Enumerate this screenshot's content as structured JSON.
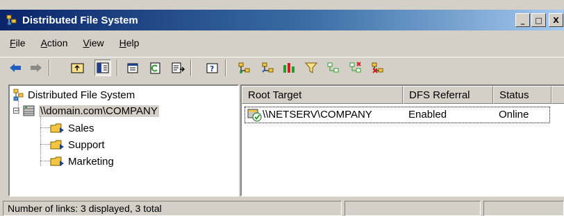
{
  "window": {
    "title": "Distributed File System"
  },
  "window_controls": {
    "minimize": "_",
    "maximize": "□",
    "close": "X"
  },
  "menu": [
    {
      "accel": "F",
      "rest": "ile"
    },
    {
      "accel": "A",
      "rest": "ction"
    },
    {
      "accel": "V",
      "rest": "iew"
    },
    {
      "accel": "H",
      "rest": "elp"
    }
  ],
  "toolbar": {
    "icons": [
      "back-arrow-icon",
      "forward-arrow-icon",
      "up-folder-icon",
      "show-hide-console-tree-icon",
      "properties-icon",
      "refresh-icon",
      "export-list-icon",
      "help-icon",
      "new-root-icon",
      "new-link-icon",
      "check-status-icon",
      "filter-icon",
      "new-root-target-icon",
      "delete-root-target-icon",
      "remove-link-icon"
    ]
  },
  "tree": {
    "root_label": "Distributed File System",
    "domain_label": "\\\\domain.com\\COMPANY",
    "expander": "⊟",
    "links": [
      "Sales",
      "Support",
      "Marketing"
    ]
  },
  "list": {
    "columns": [
      "Root Target",
      "DFS Referral",
      "Status"
    ],
    "rows": [
      {
        "root_target": "\\\\NETSERV\\COMPANY",
        "dfs_referral": "Enabled",
        "status": "Online"
      }
    ]
  },
  "statusbar": {
    "text": "Number of links: 3 displayed, 3 total"
  },
  "colors": {
    "titlebar_start": "#0a246a",
    "titlebar_end": "#a6caf0",
    "face": "#d4d0c8"
  }
}
